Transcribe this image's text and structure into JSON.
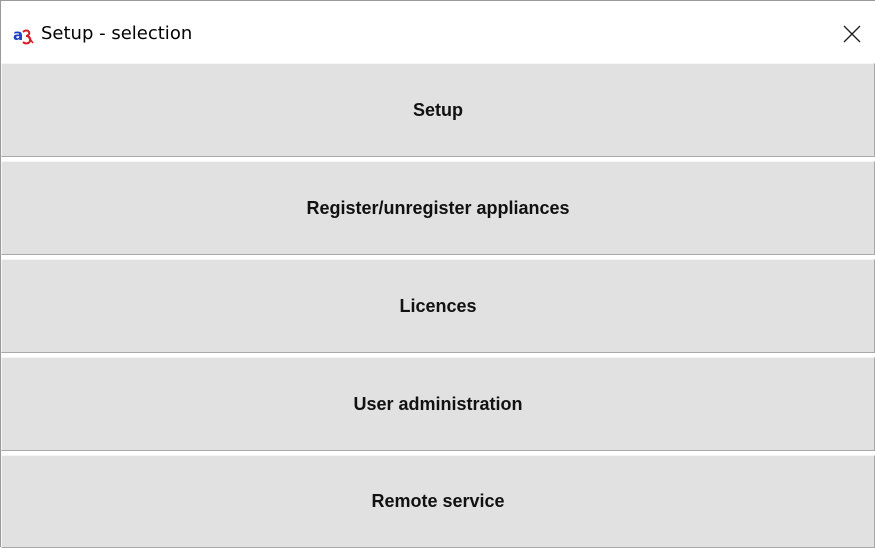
{
  "window": {
    "title": "Setup - selection",
    "app_icon": "app-logo-icon",
    "close_icon": "close-icon"
  },
  "menu": {
    "items": [
      {
        "label": "Setup"
      },
      {
        "label": "Register/unregister appliances"
      },
      {
        "label": "Licences"
      },
      {
        "label": "User administration"
      },
      {
        "label": "Remote service"
      }
    ]
  },
  "colors": {
    "button_bg": "#e1e1e1",
    "title_bg": "#ffffff",
    "icon_blue": "#1a3fc0",
    "icon_red": "#d2202a"
  }
}
